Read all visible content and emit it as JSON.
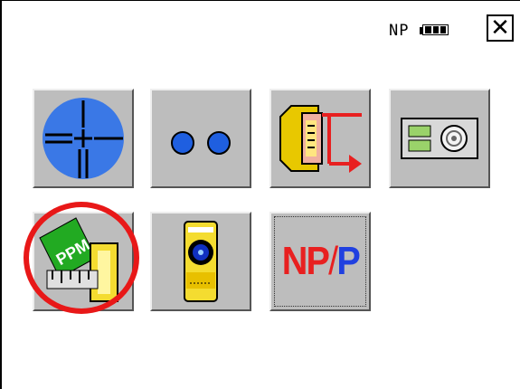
{
  "status": {
    "mode_label": "NP",
    "battery": {
      "level_bars": 3,
      "max_bars": 3
    },
    "close_glyph": "✕"
  },
  "menu": {
    "row1": [
      {
        "id": "observation",
        "icon": "crosshair-telescope-icon"
      },
      {
        "id": "target-constant",
        "icon": "two-circles-icon"
      },
      {
        "id": "data-output",
        "icon": "memory-card-export-icon"
      },
      {
        "id": "memory",
        "icon": "storage-disc-icon"
      }
    ],
    "row2": [
      {
        "id": "ppm-correction",
        "icon": "ppm-ruler-icon",
        "highlighted": true
      },
      {
        "id": "prism",
        "icon": "prism-target-icon"
      },
      {
        "id": "np-p-toggle",
        "icon": "np-p-text-icon",
        "np_text": "NP",
        "slash_text": "/",
        "p_text": "P",
        "focused": true
      }
    ],
    "ppm_label": "PPM"
  },
  "colors": {
    "button_face": "#bdbdbd",
    "highlight_ring": "#e81818",
    "crosshair_blue": "#3a78e6",
    "np_red": "#e82020",
    "p_blue": "#2040e0"
  }
}
